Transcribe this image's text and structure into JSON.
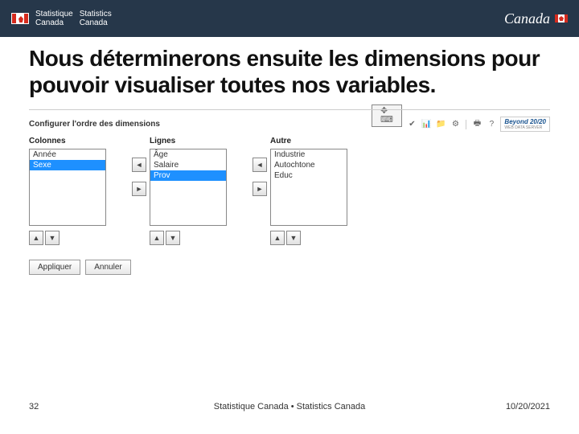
{
  "header": {
    "org_fr_1": "Statistique",
    "org_fr_2": "Canada",
    "org_en_1": "Statistics",
    "org_en_2": "Canada",
    "wordmark": "Canada"
  },
  "slide": {
    "title": "Nous déterminerons ensuite les dimensions pour pouvoir visualiser toutes nos variables."
  },
  "app": {
    "panel_title": "Configurer l'ordre des dimensions",
    "brand": "Beyond 20/20",
    "brand_sub": "WEB DATA SERVER",
    "columns": {
      "label": "Colonnes",
      "items": [
        "Année",
        "Sexe"
      ],
      "selected": 1
    },
    "lines": {
      "label": "Lignes",
      "items": [
        "Âge",
        "Salaire",
        "Prov"
      ],
      "selected": 2
    },
    "other": {
      "label": "Autre",
      "items": [
        "Industrie",
        "Autochtone",
        "Educ"
      ],
      "selected": -1
    },
    "buttons": {
      "apply": "Appliquer",
      "cancel": "Annuler"
    },
    "arrows": {
      "left": "◄",
      "right": "►",
      "up": "▲",
      "down": "▼"
    }
  },
  "footer": {
    "page": "32",
    "center": "Statistique Canada • Statistics Canada",
    "date": "10/20/2021"
  }
}
